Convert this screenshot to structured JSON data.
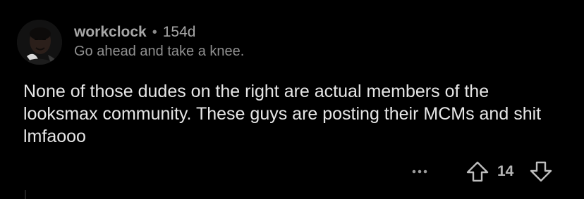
{
  "comment": {
    "username": "workclock",
    "separator": "•",
    "age": "154d",
    "flair": "Go ahead and take a knee.",
    "body": "None of those dudes on the right are actual members of the looksmax community. These guys are posting their MCMs and shit lmfaooo",
    "score": "14"
  },
  "icons": {
    "avatar": "user-avatar",
    "more": "more-options-icon",
    "upvote": "upvote-arrow-icon",
    "downvote": "downvote-arrow-icon"
  },
  "colors": {
    "background": "#000000",
    "username": "#a7a7a7",
    "body_text": "#e6e6e6",
    "icon": "#bdbdbd"
  }
}
